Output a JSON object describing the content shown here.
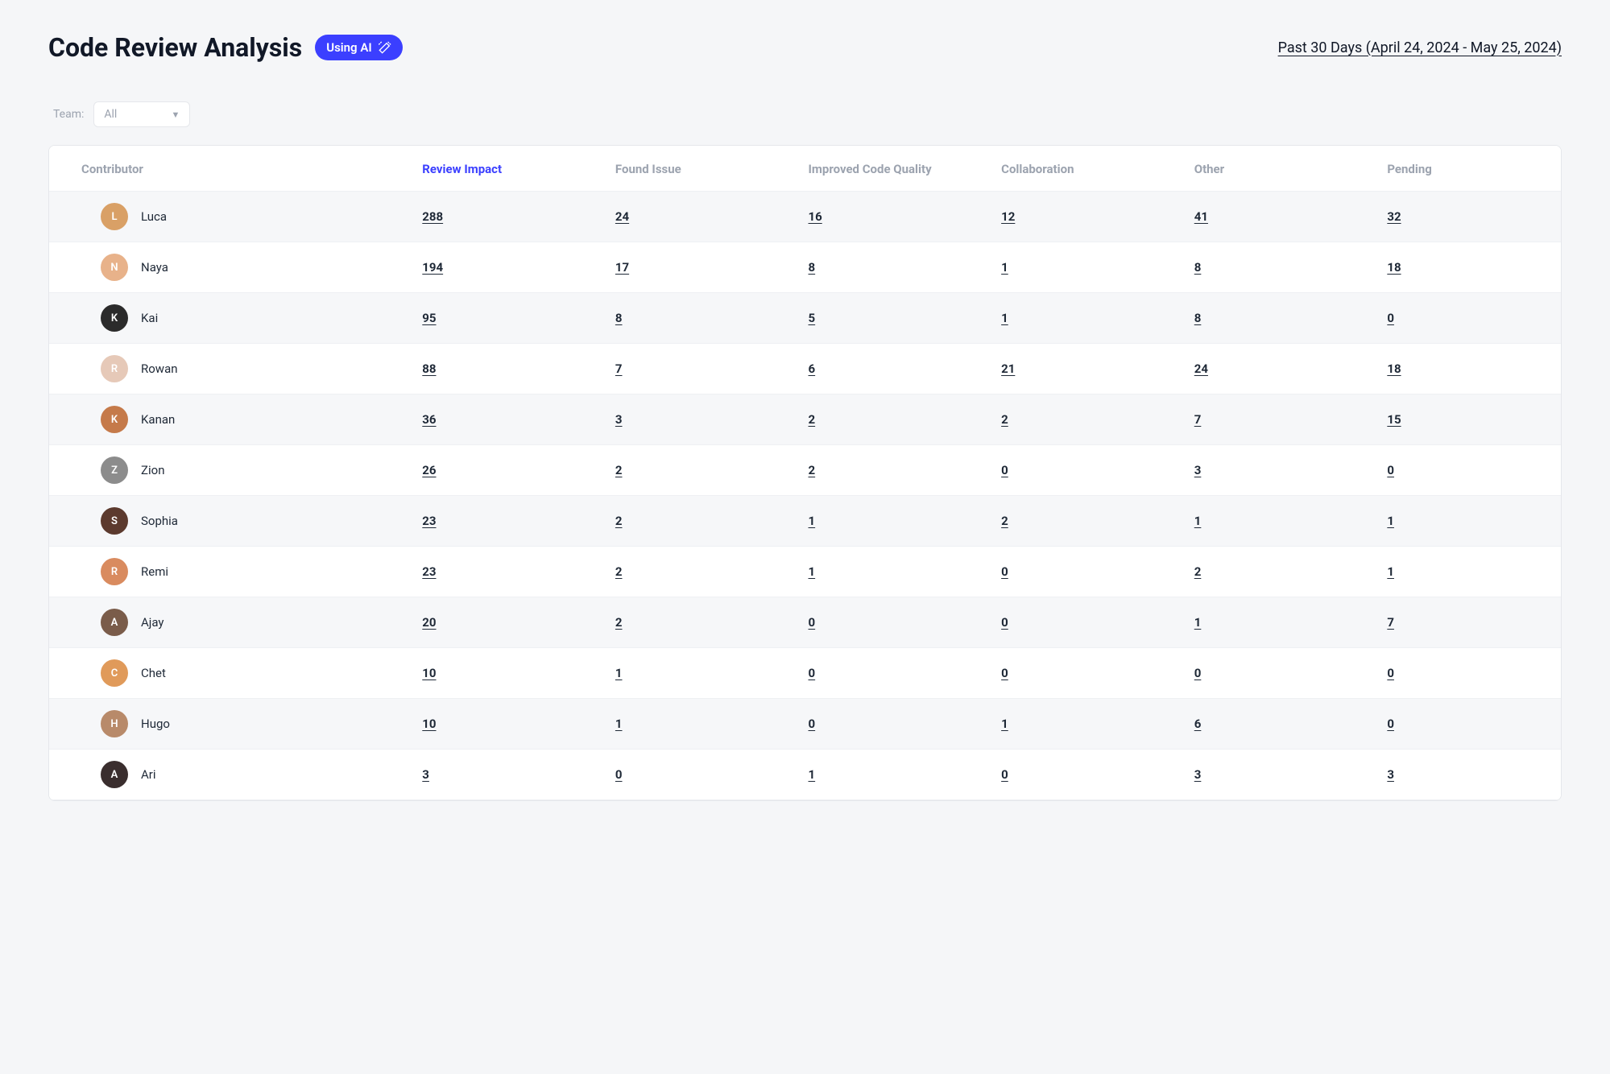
{
  "header": {
    "title": "Code Review Analysis",
    "ai_badge": "Using AI",
    "date_range": "Past 30 Days (April 24, 2024 - May 25, 2024)"
  },
  "filter": {
    "label": "Team:",
    "value": "All"
  },
  "columns": [
    {
      "key": "contributor",
      "label": "Contributor",
      "active": false
    },
    {
      "key": "review_impact",
      "label": "Review Impact",
      "active": true
    },
    {
      "key": "found_issue",
      "label": "Found Issue",
      "active": false
    },
    {
      "key": "improved_quality",
      "label": "Improved Code Quality",
      "active": false
    },
    {
      "key": "collaboration",
      "label": "Collaboration",
      "active": false
    },
    {
      "key": "other",
      "label": "Other",
      "active": false
    },
    {
      "key": "pending",
      "label": "Pending",
      "active": false
    }
  ],
  "avatar_colors": [
    "#d9a066",
    "#e8b28a",
    "#2b2b2b",
    "#e6c9b8",
    "#c57a4a",
    "#8c8c8c",
    "#5c3a2e",
    "#d98b5f",
    "#7a5c4a",
    "#e09a5a",
    "#b88a6a",
    "#3a2e2e"
  ],
  "rows": [
    {
      "name": "Luca",
      "review_impact": "288",
      "found_issue": "24",
      "improved_quality": "16",
      "collaboration": "12",
      "other": "41",
      "pending": "32"
    },
    {
      "name": "Naya",
      "review_impact": "194",
      "found_issue": "17",
      "improved_quality": "8",
      "collaboration": "1",
      "other": "8",
      "pending": "18"
    },
    {
      "name": "Kai",
      "review_impact": "95",
      "found_issue": "8",
      "improved_quality": "5",
      "collaboration": "1",
      "other": "8",
      "pending": "0"
    },
    {
      "name": "Rowan",
      "review_impact": "88",
      "found_issue": "7",
      "improved_quality": "6",
      "collaboration": "21",
      "other": "24",
      "pending": "18"
    },
    {
      "name": "Kanan",
      "review_impact": "36",
      "found_issue": "3",
      "improved_quality": "2",
      "collaboration": "2",
      "other": "7",
      "pending": "15"
    },
    {
      "name": "Zion",
      "review_impact": "26",
      "found_issue": "2",
      "improved_quality": "2",
      "collaboration": "0",
      "other": "3",
      "pending": "0"
    },
    {
      "name": "Sophia",
      "review_impact": "23",
      "found_issue": "2",
      "improved_quality": "1",
      "collaboration": "2",
      "other": "1",
      "pending": "1"
    },
    {
      "name": "Remi",
      "review_impact": "23",
      "found_issue": "2",
      "improved_quality": "1",
      "collaboration": "0",
      "other": "2",
      "pending": "1"
    },
    {
      "name": "Ajay",
      "review_impact": "20",
      "found_issue": "2",
      "improved_quality": "0",
      "collaboration": "0",
      "other": "1",
      "pending": "7"
    },
    {
      "name": "Chet",
      "review_impact": "10",
      "found_issue": "1",
      "improved_quality": "0",
      "collaboration": "0",
      "other": "0",
      "pending": "0"
    },
    {
      "name": "Hugo",
      "review_impact": "10",
      "found_issue": "1",
      "improved_quality": "0",
      "collaboration": "1",
      "other": "6",
      "pending": "0"
    },
    {
      "name": "Ari",
      "review_impact": "3",
      "found_issue": "0",
      "improved_quality": "1",
      "collaboration": "0",
      "other": "3",
      "pending": "3"
    }
  ]
}
